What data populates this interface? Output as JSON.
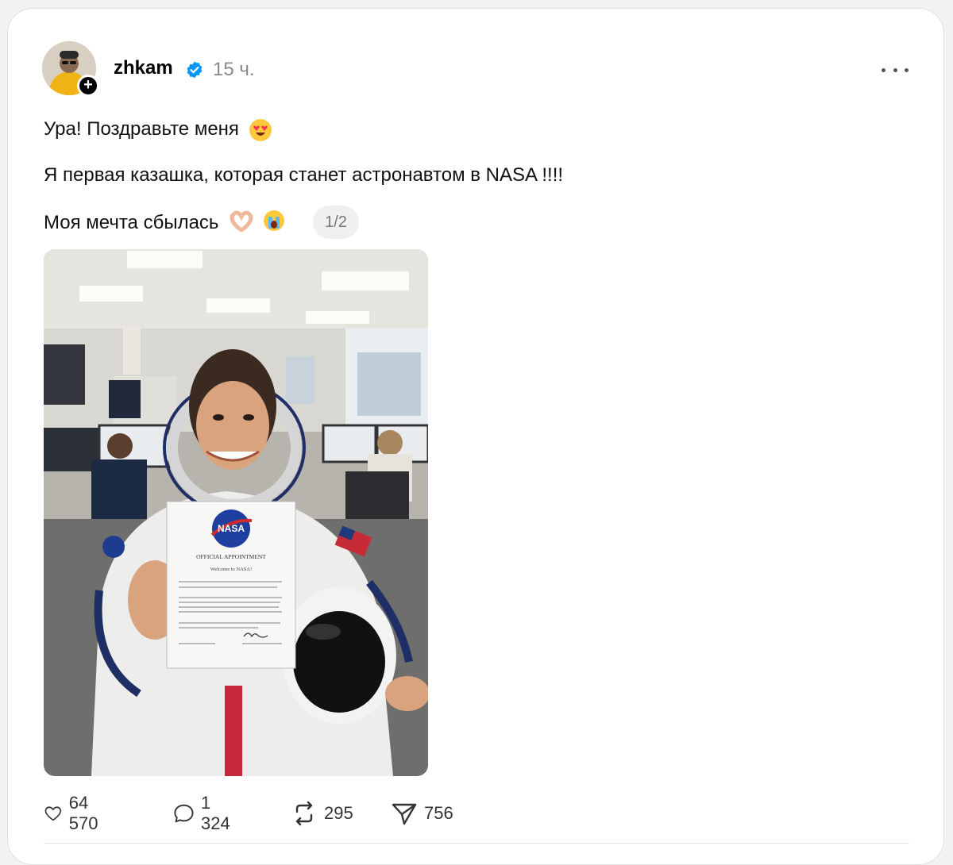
{
  "post": {
    "username": "zhkam",
    "time": "15 ч.",
    "text_lines": [
      "Ура! Поздравьте меня",
      "Я первая казашка, которая станет астронавтом в NASA !!!!",
      "Моя мечта сбылась"
    ],
    "media_counter": "1/2",
    "photo_document": {
      "header": "OFFICIAL APPOINTMENT",
      "greeting": "Welcome to NASA!",
      "logo_text": "NASA"
    }
  },
  "actions": {
    "likes": "64 570",
    "comments": "1 324",
    "reposts": "295",
    "shares": "756"
  },
  "icons": {
    "verified": "verified-badge-icon",
    "more": "more-options-icon",
    "like": "heart-icon",
    "comment": "comment-icon",
    "repost": "repost-icon",
    "share": "share-icon"
  },
  "colors": {
    "verified_blue": "#0095f6",
    "text": "#111111",
    "secondary": "#8a8a8a"
  }
}
